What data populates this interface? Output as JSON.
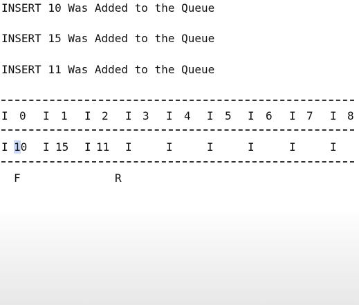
{
  "messages": [
    "INSERT 10 Was Added to the Queue",
    "INSERT 15 Was Added to the Queue",
    "INSERT 11 Was Added to the Queue"
  ],
  "queue": {
    "indices": [
      "0",
      "1",
      "2",
      "3",
      "4",
      "5",
      "6",
      "7",
      "8"
    ],
    "values": [
      "10",
      "15",
      "11",
      "",
      "",
      "",
      "",
      "",
      ""
    ],
    "separator": "I",
    "front_marker": "F",
    "rear_marker": "R"
  },
  "selection_color": "#c9d9f5"
}
